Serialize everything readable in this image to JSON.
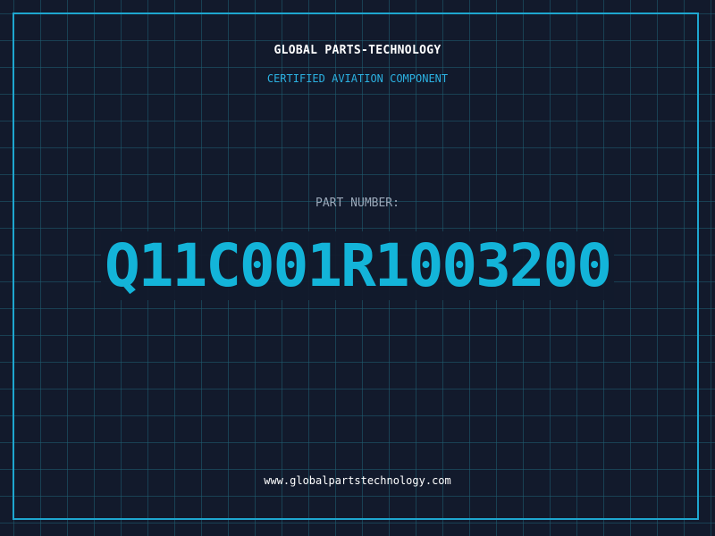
{
  "header": {
    "company": "GLOBAL PARTS-TECHNOLOGY",
    "subtitle": "CERTIFIED AVIATION COMPONENT"
  },
  "part": {
    "label": "PART NUMBER:",
    "number": "Q11C001R1003200"
  },
  "footer": {
    "website": "www.globalpartstechnology.com"
  },
  "colors": {
    "background": "#121a2c",
    "grid": "#1f5f73",
    "frame": "#1ea6cf",
    "accent": "#13b4d9"
  }
}
